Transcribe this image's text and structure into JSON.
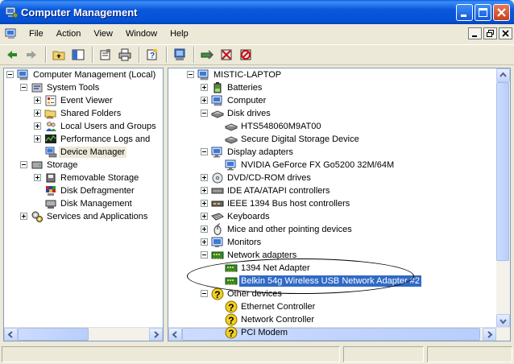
{
  "window": {
    "title": "Computer Management"
  },
  "menu": [
    "File",
    "Action",
    "View",
    "Window",
    "Help"
  ],
  "toolbar_icons": [
    "back-arrow-icon",
    "forward-arrow-icon",
    "up-folder-icon",
    "show-hide-tree-icon",
    "properties-icon",
    "print-icon",
    "help-icon",
    "scan-hardware-icon",
    "update-driver-icon",
    "uninstall-icon",
    "disable-icon"
  ],
  "left_tree": [
    {
      "label": "Computer Management (Local)",
      "icon": "computer-management-icon",
      "indent": 0,
      "expander": "minus"
    },
    {
      "label": "System Tools",
      "icon": "system-tools-icon",
      "indent": 1,
      "expander": "minus"
    },
    {
      "label": "Event Viewer",
      "icon": "event-viewer-icon",
      "indent": 2,
      "expander": "plus"
    },
    {
      "label": "Shared Folders",
      "icon": "shared-folders-icon",
      "indent": 2,
      "expander": "plus"
    },
    {
      "label": "Local Users and Groups",
      "icon": "users-icon",
      "indent": 2,
      "expander": "plus"
    },
    {
      "label": "Performance Logs and Alerts",
      "icon": "performance-icon",
      "indent": 2,
      "expander": "plus"
    },
    {
      "label": "Device Manager",
      "icon": "device-manager-icon",
      "indent": 2,
      "expander": "",
      "selected": true
    },
    {
      "label": "Storage",
      "icon": "storage-icon",
      "indent": 1,
      "expander": "minus"
    },
    {
      "label": "Removable Storage",
      "icon": "removable-storage-icon",
      "indent": 2,
      "expander": "plus"
    },
    {
      "label": "Disk Defragmenter",
      "icon": "defragmenter-icon",
      "indent": 2,
      "expander": ""
    },
    {
      "label": "Disk Management",
      "icon": "disk-management-icon",
      "indent": 2,
      "expander": ""
    },
    {
      "label": "Services and Applications",
      "icon": "services-icon",
      "indent": 1,
      "expander": "plus"
    }
  ],
  "right_tree": [
    {
      "label": "MISTIC-LAPTOP",
      "icon": "computer-icon",
      "indent": 0,
      "expander": "minus"
    },
    {
      "label": "Batteries",
      "icon": "battery-icon",
      "indent": 1,
      "expander": "plus"
    },
    {
      "label": "Computer",
      "icon": "computer-icon",
      "indent": 1,
      "expander": "plus"
    },
    {
      "label": "Disk drives",
      "icon": "disk-drive-icon",
      "indent": 1,
      "expander": "minus"
    },
    {
      "label": "HTS548060M9AT00",
      "icon": "disk-drive-icon",
      "indent": 2,
      "expander": ""
    },
    {
      "label": "Secure Digital Storage Device",
      "icon": "disk-drive-icon",
      "indent": 2,
      "expander": ""
    },
    {
      "label": "Display adapters",
      "icon": "display-adapter-icon",
      "indent": 1,
      "expander": "minus"
    },
    {
      "label": "NVIDIA GeForce FX Go5200 32M/64M",
      "icon": "display-adapter-icon",
      "indent": 2,
      "expander": ""
    },
    {
      "label": "DVD/CD-ROM drives",
      "icon": "dvd-drive-icon",
      "indent": 1,
      "expander": "plus"
    },
    {
      "label": "IDE ATA/ATAPI controllers",
      "icon": "ide-controller-icon",
      "indent": 1,
      "expander": "plus"
    },
    {
      "label": "IEEE 1394 Bus host controllers",
      "icon": "ieee1394-icon",
      "indent": 1,
      "expander": "plus"
    },
    {
      "label": "Keyboards",
      "icon": "keyboard-icon",
      "indent": 1,
      "expander": "plus"
    },
    {
      "label": "Mice and other pointing devices",
      "icon": "mouse-icon",
      "indent": 1,
      "expander": "plus"
    },
    {
      "label": "Monitors",
      "icon": "monitor-icon",
      "indent": 1,
      "expander": "plus"
    },
    {
      "label": "Network adapters",
      "icon": "network-adapter-icon",
      "indent": 1,
      "expander": "minus"
    },
    {
      "label": "1394 Net Adapter",
      "icon": "network-adapter-icon",
      "indent": 2,
      "expander": ""
    },
    {
      "label": "Belkin 54g Wireless USB Network Adapter #2",
      "icon": "network-adapter-icon",
      "indent": 2,
      "expander": "",
      "selected": true
    },
    {
      "label": "Other devices",
      "icon": "unknown-device-icon",
      "indent": 1,
      "expander": "minus"
    },
    {
      "label": "Ethernet Controller",
      "icon": "unknown-device-icon",
      "indent": 2,
      "expander": ""
    },
    {
      "label": "Network Controller",
      "icon": "unknown-device-icon",
      "indent": 2,
      "expander": ""
    },
    {
      "label": "PCI Modem",
      "icon": "unknown-device-icon",
      "indent": 2,
      "expander": ""
    }
  ],
  "colors": {
    "title_blue": "#0a58dc",
    "selection": "#316ac5",
    "face": "#ece9d8"
  }
}
